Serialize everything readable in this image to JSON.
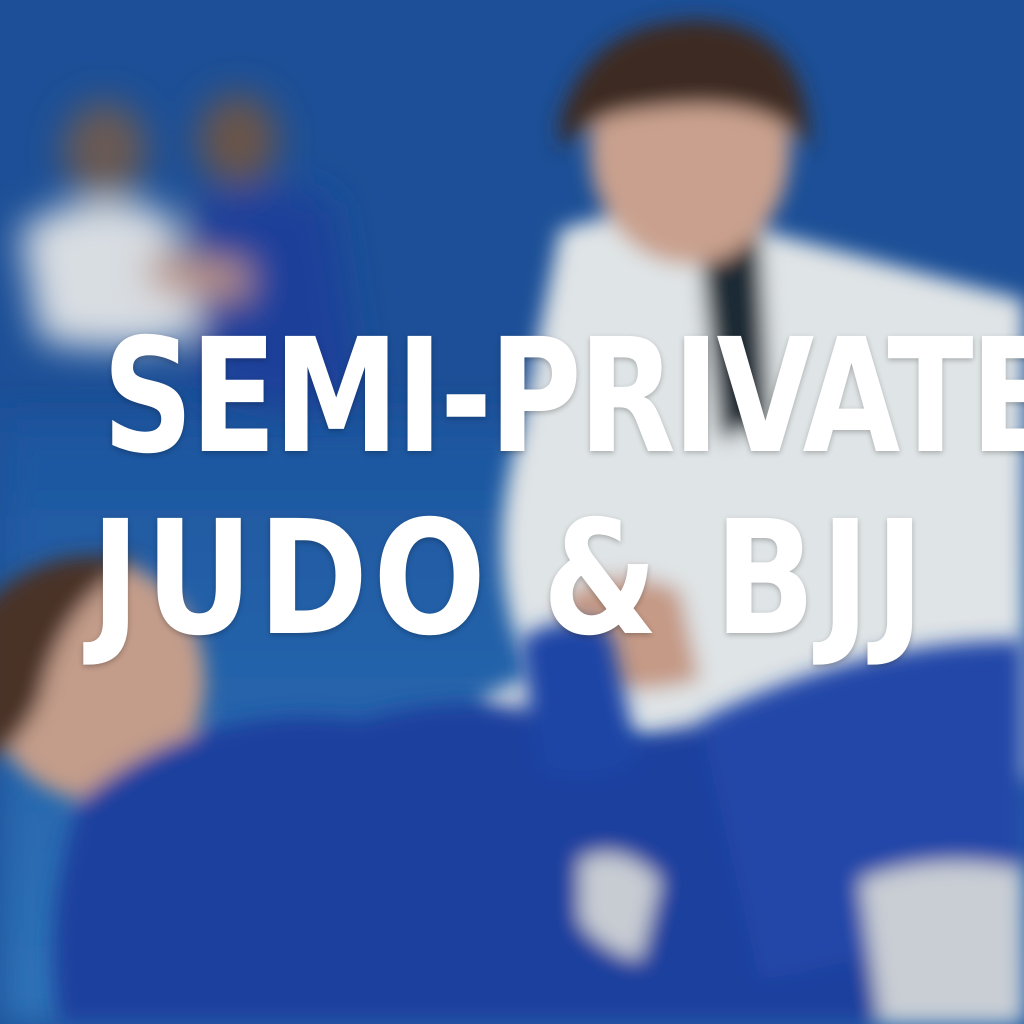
{
  "headline": {
    "line1": "SEMI-PRIVATE",
    "line2": "JUDO & BJJ"
  },
  "colors": {
    "mat_blue": "#2364ad",
    "gi_white": "#dfe4e6",
    "gi_blue": "#1e3f9e",
    "text": "#ffffff"
  }
}
